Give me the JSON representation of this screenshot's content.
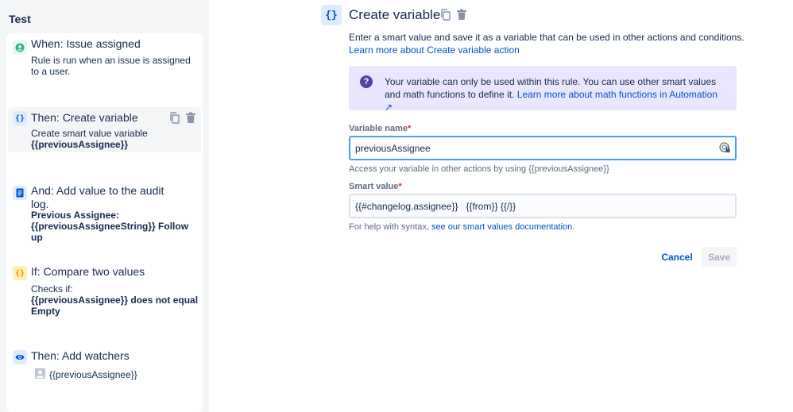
{
  "left": {
    "title": "Test",
    "components": [
      {
        "title": "When: Issue assigned",
        "desc": "Rule is run when an issue is assigned to a user.",
        "icon": "user-icon",
        "color": "#36b37e"
      },
      {
        "title": "Then: Create variable",
        "desc_prefix": "Create smart value variable",
        "desc_bold": "{{previousAssignee}}",
        "icon": "braces-icon",
        "color": "#0052cc"
      },
      {
        "title": "And: Add value to the audit log.",
        "desc_bold": "Previous Assignee: {{previousAssigneeString}} Follow up",
        "icon": "document-icon",
        "color": "#0052cc"
      },
      {
        "title": "If: Compare two values",
        "desc_prefix": "Checks if:",
        "desc_bold": "{{previousAssignee}} does not equal Empty",
        "icon": "braces-icon",
        "color": "#ff991f"
      },
      {
        "title": "Then: Add watchers",
        "desc_prefix": "{{previousAssignee}}",
        "icon": "eye-icon",
        "color": "#0052cc"
      }
    ]
  },
  "header": {
    "icon_glyph": "{}",
    "title": "Create variable"
  },
  "intro": {
    "text": "Enter a smart value and save it as a variable that can be used in other actions and conditions.",
    "link": "Learn more about Create variable action"
  },
  "info": {
    "icon_glyph": "?",
    "text": "Your variable can only be used within this rule. You can use other smart values and math functions to define it.",
    "link": "Learn more about math functions in Automation ↗"
  },
  "variable_name": {
    "label": "Variable name",
    "required": "*",
    "value": "previousAssignee",
    "helper": "Access your variable in other actions by using {{previousAssignee}}"
  },
  "smart_value": {
    "label": "Smart value",
    "required": "*",
    "value": "{{#changelog.assignee}}   {{from}} {{/}}",
    "helper_prefix": "For help with syntax,",
    "helper_link": "see our smart values documentation."
  },
  "buttons": {
    "cancel": "Cancel",
    "save": "Save"
  },
  "colors": {
    "accent": "#0052cc",
    "info_bg": "#eae6ff",
    "focus": "#4c9aff"
  }
}
